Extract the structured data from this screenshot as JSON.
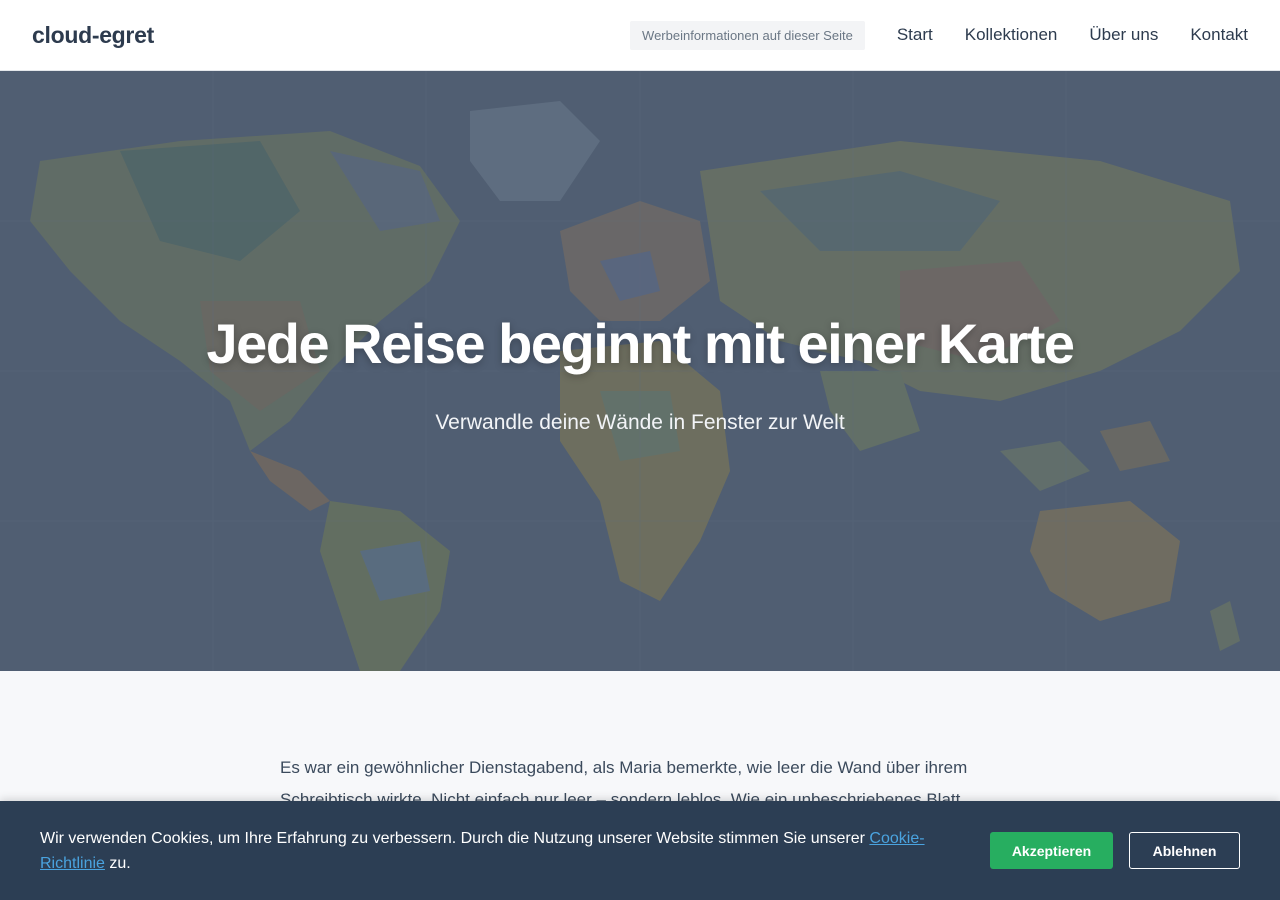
{
  "header": {
    "logo": "cloud-egret",
    "ad_label": "Werbeinformationen auf dieser Seite",
    "nav": [
      "Start",
      "Kollektionen",
      "Über uns",
      "Kontakt"
    ]
  },
  "hero": {
    "title": "Jede Reise beginnt mit einer Karte",
    "subtitle": "Verwandle deine Wände in Fenster zur Welt"
  },
  "article": {
    "paragraph": "Es war ein gewöhnlicher Dienstagabend, als Maria bemerkte, wie leer die Wand über ihrem Schreibtisch wirkte. Nicht einfach nur leer – sondern leblos. Wie ein unbeschriebenes Blatt"
  },
  "cookie": {
    "text_before": "Wir verwenden Cookies, um Ihre Erfahrung zu verbessern. Durch die Nutzung unserer Website stimmen Sie unserer ",
    "link": "Cookie-Richtlinie",
    "text_after": " zu.",
    "accept": "Akzeptieren",
    "decline": "Ablehnen"
  },
  "colors": {
    "nav_text": "#2d3b4e",
    "cookie_bg": "#2c3e54",
    "accept_green": "#27ae60",
    "link_blue": "#4aa3df"
  }
}
